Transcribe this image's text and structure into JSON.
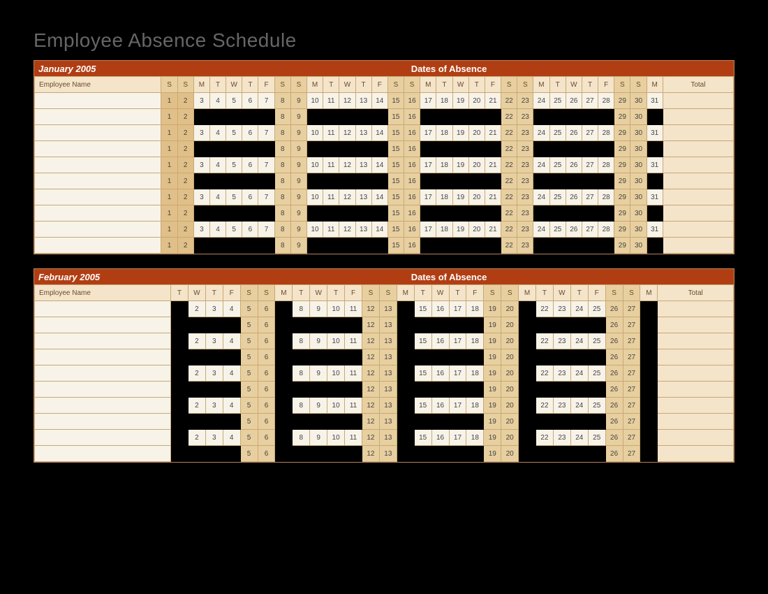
{
  "title": "Employee Absence Schedule",
  "labels": {
    "empName": "Employee Name",
    "dates": "Dates of Absence",
    "total": "Total"
  },
  "months": [
    {
      "name": "January 2005",
      "columns": 31,
      "daysInMonth": 31,
      "startDow": 6,
      "dowLetters": [
        "S",
        "S",
        "M",
        "T",
        "W",
        "T",
        "F",
        "S",
        "S",
        "M",
        "T",
        "W",
        "T",
        "F",
        "S",
        "S",
        "M",
        "T",
        "W",
        "T",
        "F",
        "S",
        "S",
        "M",
        "T",
        "W",
        "T",
        "F",
        "S",
        "S",
        "M"
      ],
      "rows": [
        {
          "pattern": "full"
        },
        {
          "pattern": "weekends"
        },
        {
          "pattern": "full"
        },
        {
          "pattern": "weekends"
        },
        {
          "pattern": "full"
        },
        {
          "pattern": "weekends"
        },
        {
          "pattern": "full"
        },
        {
          "pattern": "weekends"
        },
        {
          "pattern": "full"
        },
        {
          "pattern": "weekends"
        }
      ]
    },
    {
      "name": "February 2005",
      "columns": 28,
      "daysInMonth": 28,
      "startDow": 2,
      "dowLetters": [
        "T",
        "W",
        "T",
        "F",
        "S",
        "S",
        "M",
        "T",
        "W",
        "T",
        "F",
        "S",
        "S",
        "M",
        "T",
        "W",
        "T",
        "F",
        "S",
        "S",
        "M",
        "T",
        "W",
        "T",
        "F",
        "S",
        "S",
        "M"
      ],
      "rows": [
        {
          "pattern": "feb-a"
        },
        {
          "pattern": "feb-b"
        },
        {
          "pattern": "feb-a"
        },
        {
          "pattern": "feb-b"
        },
        {
          "pattern": "feb-a"
        },
        {
          "pattern": "feb-b"
        },
        {
          "pattern": "feb-a"
        },
        {
          "pattern": "feb-b"
        },
        {
          "pattern": "feb-a"
        },
        {
          "pattern": "feb-b"
        }
      ]
    }
  ]
}
